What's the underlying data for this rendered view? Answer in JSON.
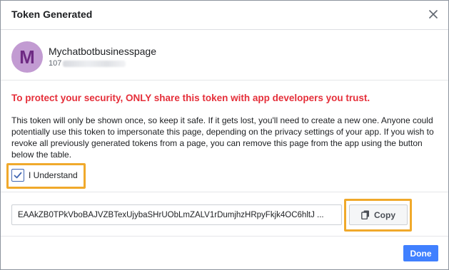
{
  "dialog": {
    "title": "Token Generated",
    "close_icon": "close-icon"
  },
  "page": {
    "avatar_letter": "M",
    "avatar_color": "#c29bd2",
    "name": "Mychatbotbusinesspage",
    "id_visible": "107"
  },
  "warning_text": "To protect your security, ONLY share this token with app developers you trust.",
  "info_text": "This token will only be shown once, so keep it safe. If it gets lost, you'll need to create a new one. Anyone could potentially use this token to impersonate this page, depending on the privacy settings of your app. If you wish to revoke all previously generated tokens from a page, you can remove this page from the app using the button below the table.",
  "understand": {
    "label": "I Understand",
    "checked": true
  },
  "token": {
    "value": "EAAkZB0TPkVboBAJVZBTexUjybaSHrUObLmZALV1rDumjhzHRpyFkjk4OC6hltJ ..."
  },
  "copy_button": {
    "label": "Copy",
    "icon": "copy-icon"
  },
  "done_button": {
    "label": "Done"
  },
  "colors": {
    "warning": "#e52f3a",
    "accent": "#4080ff",
    "highlight": "#f0a92b"
  }
}
